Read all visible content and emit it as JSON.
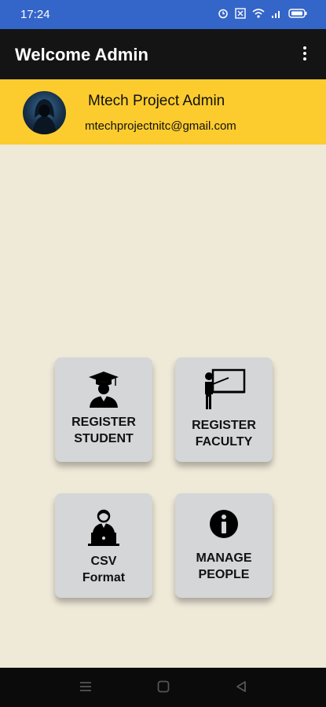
{
  "status_bar": {
    "time": "17:24",
    "icons": [
      "alarm-icon",
      "data-icon",
      "wifi-icon",
      "signal-icon",
      "battery-icon"
    ]
  },
  "app_bar": {
    "title": "Welcome Admin",
    "menu_icon": "more-vert-icon"
  },
  "profile": {
    "name": "Mtech Project Admin",
    "email": "mtechprojectnitc@gmail.com"
  },
  "tiles": [
    {
      "label": "REGISTER\nSTUDENT",
      "icon": "graduate-icon"
    },
    {
      "label": "REGISTER\nFACULTY",
      "icon": "teacher-board-icon"
    },
    {
      "label": "CSV\nFormat",
      "icon": "person-laptop-icon"
    },
    {
      "label": "MANAGE\nPEOPLE",
      "icon": "info-icon"
    }
  ],
  "nav_bar": {
    "buttons": [
      "menu-icon",
      "home-icon",
      "back-icon"
    ]
  },
  "colors": {
    "status_bar": "#3465c9",
    "app_bar": "#141414",
    "profile_band": "#fccc2e",
    "background": "#efe9d8",
    "tile": "#d4d6d7"
  }
}
